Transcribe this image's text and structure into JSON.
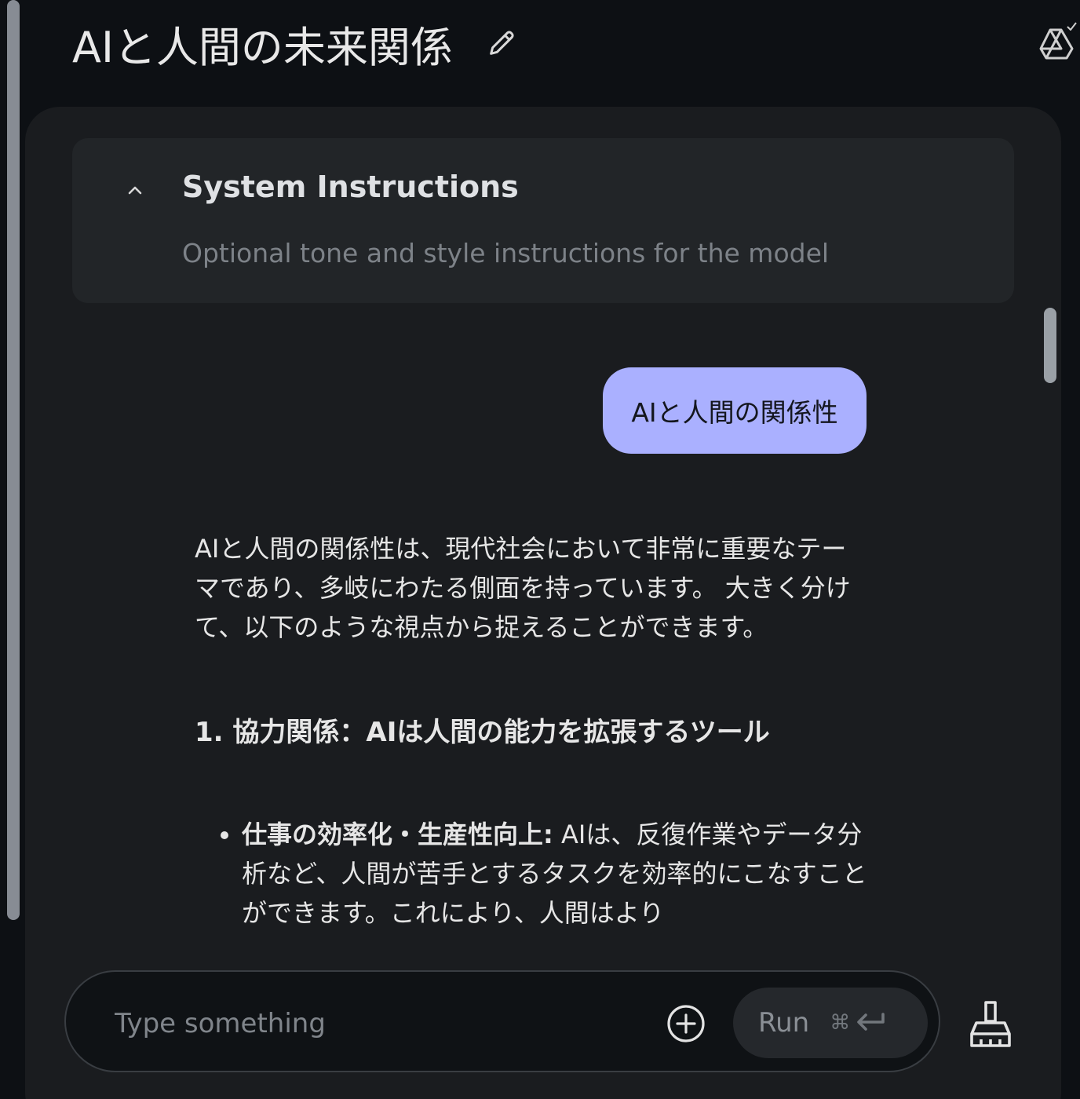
{
  "header": {
    "title": "AIと人間の未来関係",
    "edit_icon": "pencil-icon",
    "drive_icon": "drive-saved-icon"
  },
  "system_instructions": {
    "title": "System Instructions",
    "placeholder": "Optional tone and style instructions for the model",
    "chevron_icon": "chevron-up-icon",
    "expanded": true
  },
  "chat": {
    "user_message": "AIと人間の関係性",
    "response": {
      "intro": "AIと人間の関係性は、現代社会において非常に重要なテーマであり、多岐にわたる側面を持っています。 大きく分けて、以下のような視点から捉えることができます。",
      "heading": "1. 協力関係：AIは人間の能力を拡張するツール",
      "bullets": [
        {
          "bold": "仕事の効率化・生産性向上:",
          "text": " AIは、反復作業やデータ分析など、人間が苦手とするタスクを効率的にこなすことができます。これにより、人間はより"
        }
      ]
    }
  },
  "composer": {
    "placeholder": "Type something",
    "add_icon": "add-circle-icon",
    "run_label": "Run",
    "run_shortcut": "⌘",
    "run_shortcut_icon": "enter-arrow-icon",
    "clear_icon": "broom-icon"
  },
  "colors": {
    "background": "#0d1014",
    "panel": "#1a1c1f",
    "system_box": "#222528",
    "user_bubble": "#aab0ff",
    "run_button": "#25282c"
  }
}
